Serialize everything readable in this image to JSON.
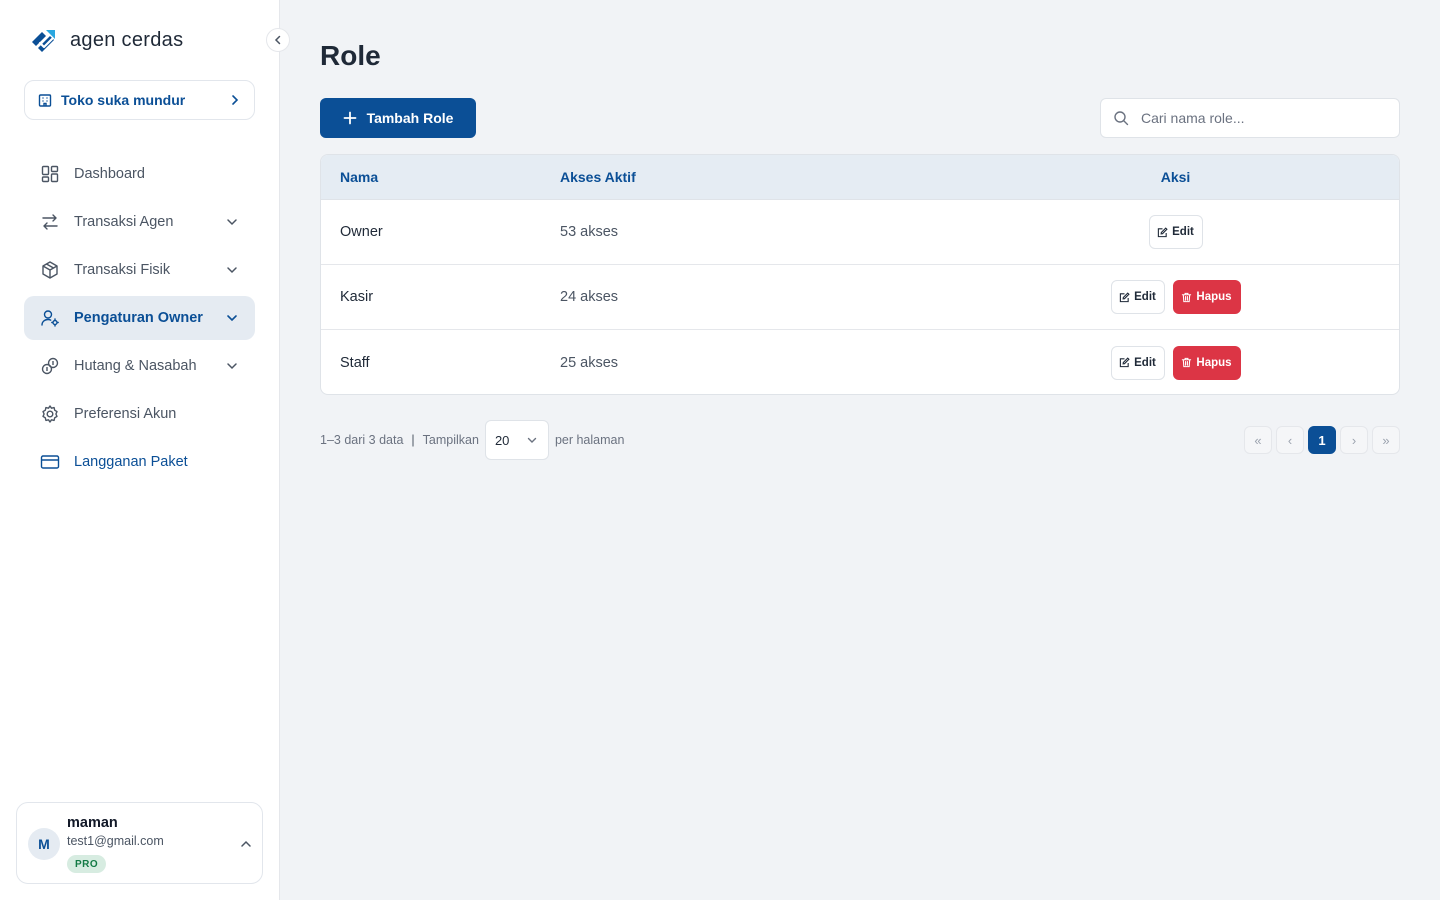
{
  "app": {
    "name": "agen cerdas"
  },
  "store": {
    "name": "Toko suka mundur"
  },
  "sidebar": {
    "items": [
      {
        "label": "Dashboard",
        "icon": "dashboard-icon",
        "expandable": false
      },
      {
        "label": "Transaksi Agen",
        "icon": "transfer-arrows-icon",
        "expandable": true
      },
      {
        "label": "Transaksi Fisik",
        "icon": "package-icon",
        "expandable": true
      },
      {
        "label": "Pengaturan Owner",
        "icon": "user-settings-icon",
        "expandable": true,
        "active": true
      },
      {
        "label": "Hutang & Nasabah",
        "icon": "coins-icon",
        "expandable": true
      },
      {
        "label": "Preferensi Akun",
        "icon": "gear-icon",
        "expandable": false
      },
      {
        "label": "Langganan Paket",
        "icon": "credit-card-icon",
        "expandable": false
      }
    ]
  },
  "user": {
    "initial": "M",
    "name": "maman",
    "email": "test1@gmail.com",
    "badge": "PRO"
  },
  "page": {
    "title": "Role",
    "add_button": "Tambah Role",
    "search_placeholder": "Cari nama role..."
  },
  "table": {
    "headers": {
      "nama": "Nama",
      "akses": "Akses Aktif",
      "aksi": "Aksi"
    },
    "edit_label": "Edit",
    "delete_label": "Hapus",
    "rows": [
      {
        "nama": "Owner",
        "akses": "53 akses",
        "deletable": false
      },
      {
        "nama": "Kasir",
        "akses": "24 akses",
        "deletable": true
      },
      {
        "nama": "Staff",
        "akses": "25 akses",
        "deletable": true
      }
    ]
  },
  "pagination": {
    "summary": "1–3 dari 3 data",
    "show_label": "Tampilkan",
    "page_size": "20",
    "per_page_label": "per halaman",
    "current_page": "1",
    "first": "«",
    "prev": "‹",
    "next": "›",
    "last": "»"
  },
  "colors": {
    "primary": "#0b4f96",
    "danger": "#dc3545",
    "badge_bg": "#d7ece1"
  }
}
